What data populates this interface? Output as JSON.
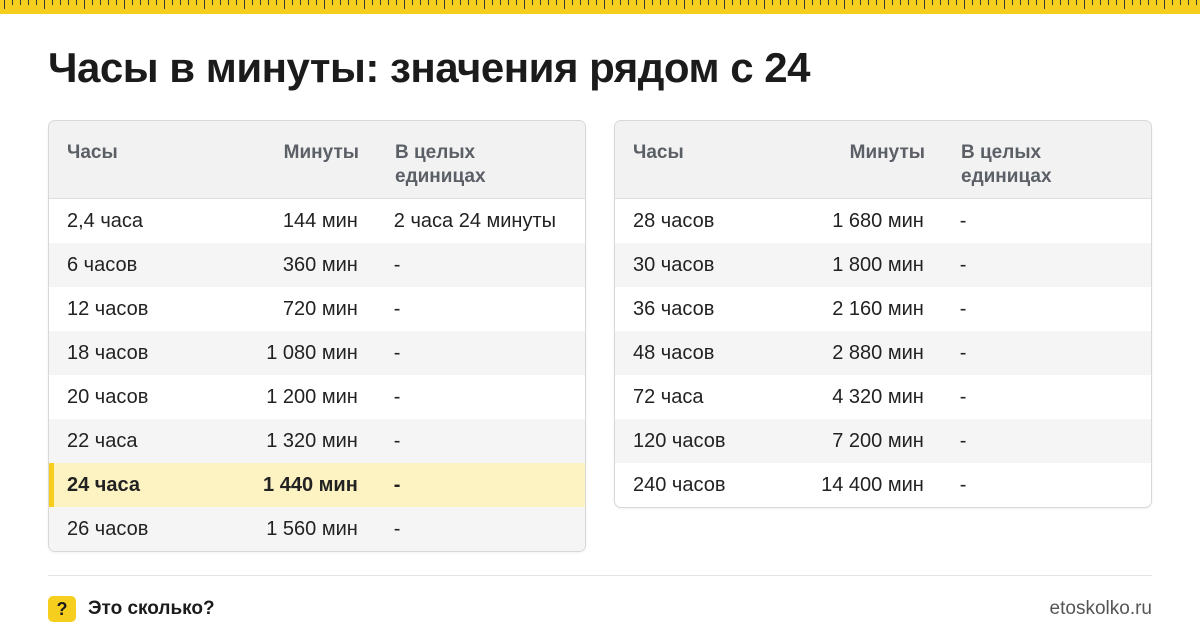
{
  "title": "Часы в минуты: значения рядом с 24",
  "colors": {
    "accent": "#f6cf1e",
    "highlight_bg": "#fdf3c2",
    "header_bg": "#f2f2f2"
  },
  "table_left": {
    "headers": [
      "Часы",
      "Минуты",
      "В целых единицах"
    ],
    "rows": [
      [
        "2,4 часа",
        "144 мин",
        "2 часа 24 минуты"
      ],
      [
        "6 часов",
        "360 мин",
        "-"
      ],
      [
        "12 часов",
        "720 мин",
        "-"
      ],
      [
        "18 часов",
        "1 080 мин",
        "-"
      ],
      [
        "20 часов",
        "1 200 мин",
        "-"
      ],
      [
        "22 часа",
        "1 320 мин",
        "-"
      ],
      [
        "24 часа",
        "1 440 мин",
        "-"
      ],
      [
        "26 часов",
        "1 560 мин",
        "-"
      ]
    ],
    "highlight_row": 6
  },
  "table_right": {
    "headers": [
      "Часы",
      "Минуты",
      "В целых единицах"
    ],
    "rows": [
      [
        "28 часов",
        "1 680 мин",
        "-"
      ],
      [
        "30 часов",
        "1 800 мин",
        "-"
      ],
      [
        "36 часов",
        "2 160 мин",
        "-"
      ],
      [
        "48 часов",
        "2 880 мин",
        "-"
      ],
      [
        "72 часа",
        "4 320 мин",
        "-"
      ],
      [
        "120 часов",
        "7 200 мин",
        "-"
      ],
      [
        "240 часов",
        "14 400 мин",
        "-"
      ]
    ]
  },
  "footer": {
    "badge": "?",
    "brand": "Это сколько?",
    "site": "etoskolko.ru"
  }
}
